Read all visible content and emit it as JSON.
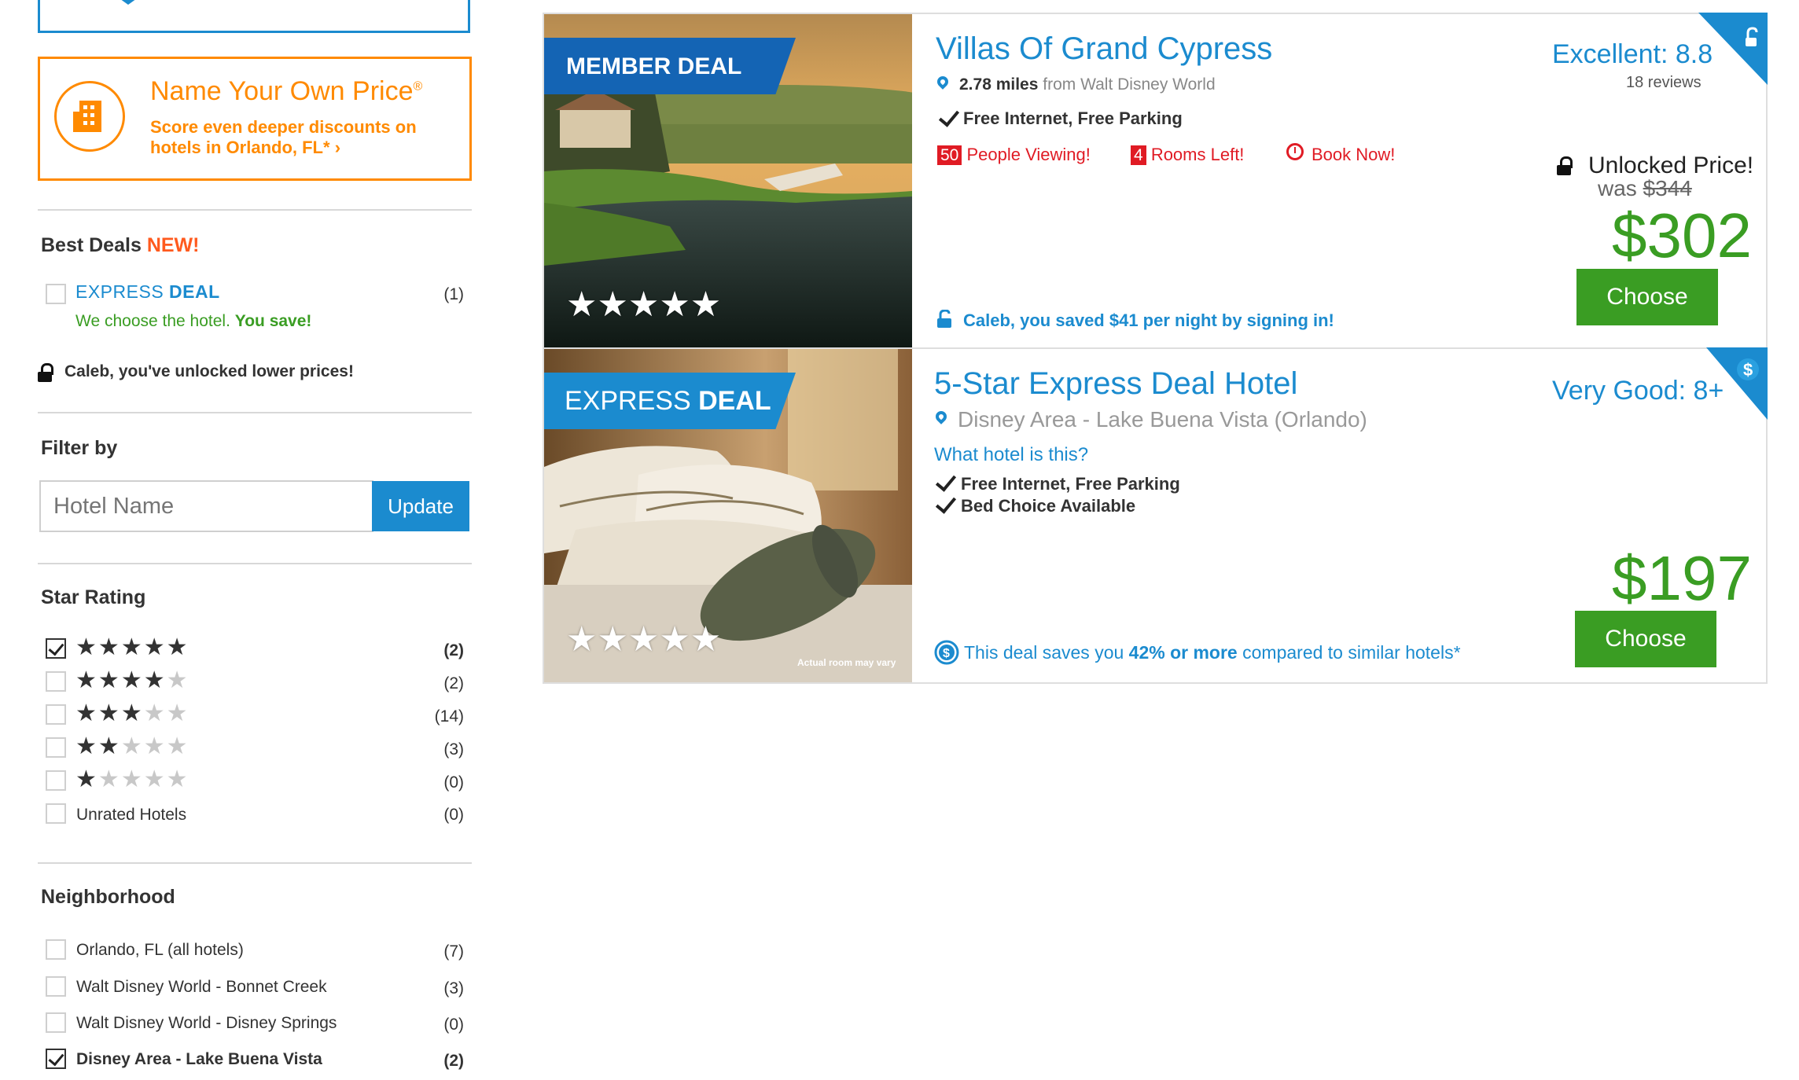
{
  "sidebar": {
    "nyop": {
      "title": "Name Your Own Price",
      "reg": "®",
      "subtitle": "Score even deeper discounts on hotels in Orlando, FL*",
      "chevron": "›"
    },
    "best_deals": {
      "heading": "Best Deals",
      "new_badge": "NEW!",
      "express": {
        "label_light": "EXPRESS",
        "label_bold": "DEAL",
        "count": "(1)"
      },
      "tagline_plain": "We choose the hotel.",
      "tagline_bold": "You save!",
      "unlock_msg": "Caleb, you've unlocked lower prices!"
    },
    "filter": {
      "heading": "Filter by",
      "placeholder": "Hotel Name",
      "update_label": "Update"
    },
    "star_rating": {
      "heading": "Star Rating",
      "options": [
        {
          "stars": 5,
          "count": "(2)",
          "checked": true
        },
        {
          "stars": 4,
          "count": "(2)",
          "checked": false
        },
        {
          "stars": 3,
          "count": "(14)",
          "checked": false
        },
        {
          "stars": 2,
          "count": "(3)",
          "checked": false
        },
        {
          "stars": 1,
          "count": "(0)",
          "checked": false
        }
      ],
      "unrated": {
        "label": "Unrated Hotels",
        "count": "(0)"
      }
    },
    "neighborhood": {
      "heading": "Neighborhood",
      "options": [
        {
          "label": "Orlando, FL (all hotels)",
          "count": "(7)",
          "checked": false
        },
        {
          "label": "Walt Disney World - Bonnet Creek",
          "count": "(3)",
          "checked": false
        },
        {
          "label": "Walt Disney World - Disney Springs",
          "count": "(0)",
          "checked": false
        },
        {
          "label": "Disney Area - Lake Buena Vista",
          "count": "(2)",
          "checked": true
        }
      ]
    }
  },
  "listings": [
    {
      "banner": "MEMBER DEAL",
      "name": "Villas Of Grand Cypress",
      "distance_bold": "2.78 miles",
      "distance_rest": "from Walt Disney World",
      "amenities": "Free Internet, Free Parking",
      "viewing_count": "50",
      "viewing_label": "People Viewing!",
      "rooms_count": "4",
      "rooms_label": "Rooms Left!",
      "book_label": "Book Now!",
      "rating": "Excellent: 8.8",
      "reviews": "18 reviews",
      "unlocked": "Unlocked Price!",
      "was_label": "was",
      "was_price": "$344",
      "price": "$302",
      "choose": "Choose",
      "saved_msg": "Caleb, you saved $41 per night by signing in!",
      "stars": "★★★★★"
    },
    {
      "banner_light": "EXPRESS",
      "banner_bold": "DEAL",
      "name": "5-Star Express Deal Hotel",
      "location": "Disney Area - Lake Buena Vista (Orlando)",
      "what_hotel": "What hotel is this?",
      "amenity1": "Free Internet, Free Parking",
      "amenity2": "Bed Choice Available",
      "rating": "Very Good: 8+",
      "price": "$197",
      "choose": "Choose",
      "save_plain1": "This deal saves you",
      "save_bold": "42% or more",
      "save_plain2": "compared to similar hotels*",
      "photo_caption": "Actual room may vary",
      "stars": "★★★★★"
    }
  ],
  "colors": {
    "brand_blue": "#1b8bcf",
    "orange": "#ff8a00",
    "green": "#3a9d23",
    "red": "#e01b24"
  }
}
